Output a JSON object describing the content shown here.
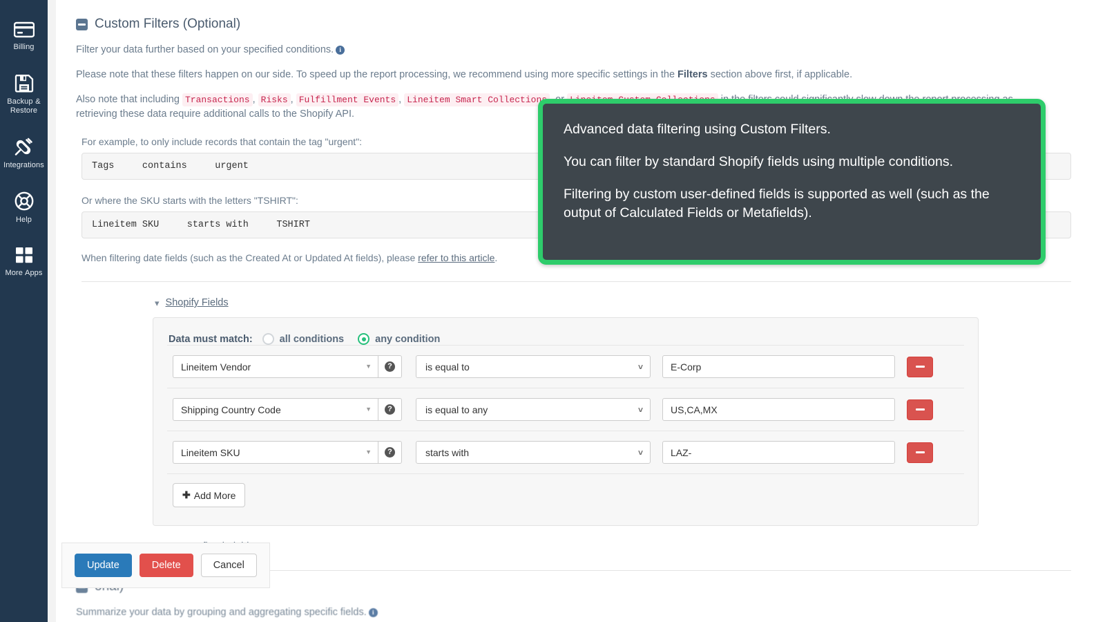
{
  "sidebar": {
    "items": [
      {
        "label": "Billing",
        "icon": "credit-card-icon"
      },
      {
        "label": "Backup & Restore",
        "icon": "floppy-disk-icon"
      },
      {
        "label": "Integrations",
        "icon": "plug-icon"
      },
      {
        "label": "Help",
        "icon": "life-ring-icon"
      },
      {
        "label": "More Apps",
        "icon": "grid-apps-icon"
      }
    ]
  },
  "section": {
    "title": "Custom Filters (Optional)",
    "collapse_icon": "collapse-minus-icon",
    "desc1": "Filter your data further based on your specified conditions.",
    "desc2_a": "Please note that these filters happen on our side. To speed up the report processing, we recommend using more specific settings in the ",
    "desc2_bold": "Filters",
    "desc2_b": " section above first, if applicable.",
    "desc3_a": "Also note that including ",
    "desc3_code1": "Transactions",
    "desc3_sep1": ", ",
    "desc3_code2": "Risks",
    "desc3_sep2": ", ",
    "desc3_code3": "Fulfillment Events",
    "desc3_sep3": ", ",
    "desc3_code4": "Lineitem Smart Collections",
    "desc3_sep4": ", or ",
    "desc3_code5": "Lineitem Custom Collections",
    "desc3_b": " in the filters could significantly slow down the report processing as retrieving these data require additional calls to the Shopify API."
  },
  "examples": [
    {
      "label": "For example, to only include records that contain the tag \"urgent\":",
      "code": "Tags     contains     urgent"
    },
    {
      "label": "Or where the SKU starts with the letters \"TSHIRT\":",
      "code": "Lineitem SKU     starts with     TSHIRT"
    }
  ],
  "date_note": {
    "prefix": "When filtering date fields (such as the Created At or Updated At fields), please ",
    "link": "refer to this article",
    "suffix": "."
  },
  "shopify_fields": {
    "link_label": "Shopify Fields",
    "chevron": "chevron-down-icon",
    "match_label": "Data must match:",
    "options": [
      {
        "label": "all conditions",
        "selected": false
      },
      {
        "label": "any condition",
        "selected": true
      }
    ],
    "rows": [
      {
        "field": "Lineitem Vendor",
        "operator": "is equal to",
        "value": "E-Corp",
        "help_icon": "help-circle-icon",
        "remove_icon": "minus-icon"
      },
      {
        "field": "Shipping Country Code",
        "operator": "is equal to any",
        "value": "US,CA,MX",
        "help_icon": "help-circle-icon",
        "remove_icon": "minus-icon"
      },
      {
        "field": "Lineitem SKU",
        "operator": "starts with",
        "value": "LAZ-",
        "help_icon": "help-circle-icon",
        "remove_icon": "minus-icon"
      }
    ],
    "add_more_label": "Add More"
  },
  "user_defined_fields": {
    "link_label": "User-Defined Fields",
    "chevron": "chevron-right-icon",
    "help_icon": "help-circle-icon"
  },
  "next_section": {
    "title_partial": "onal)",
    "desc": "Summarize your data by grouping and aggregating specific fields."
  },
  "actions": {
    "update_label": "Update",
    "delete_label": "Delete",
    "cancel_label": "Cancel"
  },
  "callout": {
    "line1": "Advanced data filtering using Custom Filters.",
    "line2": "You can filter by standard Shopify fields using multiple conditions.",
    "line3": "Filtering by custom user-defined fields is supported as well (such as the output of Calculated Fields or Metafields)."
  },
  "colors": {
    "sidebar_bg": "#22384f",
    "callout_border": "#2ecc6b",
    "callout_bg": "#3e464c",
    "radio_accent": "#27c07c",
    "primary": "#2a7ab9",
    "danger": "#e2504c",
    "code_text": "#c7254e"
  }
}
